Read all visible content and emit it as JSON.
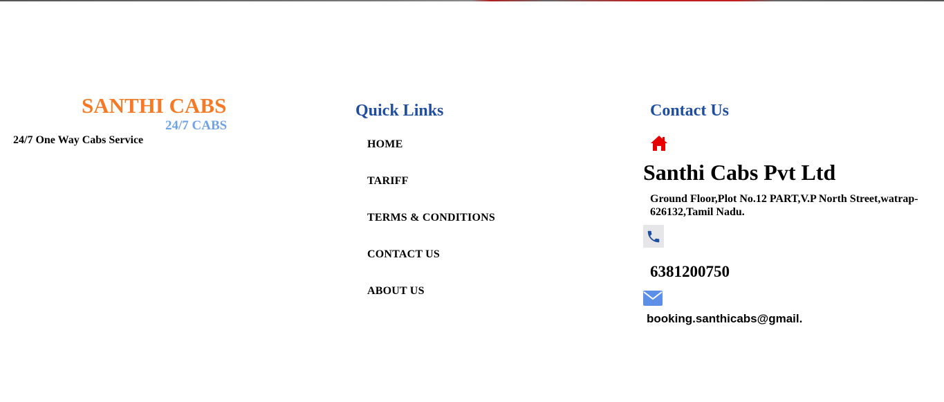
{
  "brand": {
    "name": "SANTHI CABS",
    "subtitle": "24/7 CABS",
    "tagline": "24/7 One Way Cabs Service",
    "primary_color": "#f47a25",
    "secondary_color": "#6ea3e6"
  },
  "quick_links": {
    "heading": "Quick Links",
    "items": [
      {
        "label": "HOME"
      },
      {
        "label": "TARIFF"
      },
      {
        "label": "TERMS & CONDITIONS"
      },
      {
        "label": "CONTACT US"
      },
      {
        "label": "ABOUT US"
      }
    ]
  },
  "contact": {
    "heading": "Contact Us",
    "home_icon": "home-icon",
    "company": "Santhi Cabs Pvt Ltd",
    "address": "Ground Floor,Plot No.12 PART,V.P North Street,watrap-626132,Tamil Nadu.",
    "phone_icon": "phone-icon",
    "phone": "6381200750",
    "mail_icon": "envelope-icon",
    "email": "booking.santhicabs@gmail."
  },
  "colors": {
    "heading": "#1f4ea1",
    "home_icon": "#e60000",
    "phone_icon": "#1f4ea1",
    "mail_icon": "#5b8fe8"
  }
}
